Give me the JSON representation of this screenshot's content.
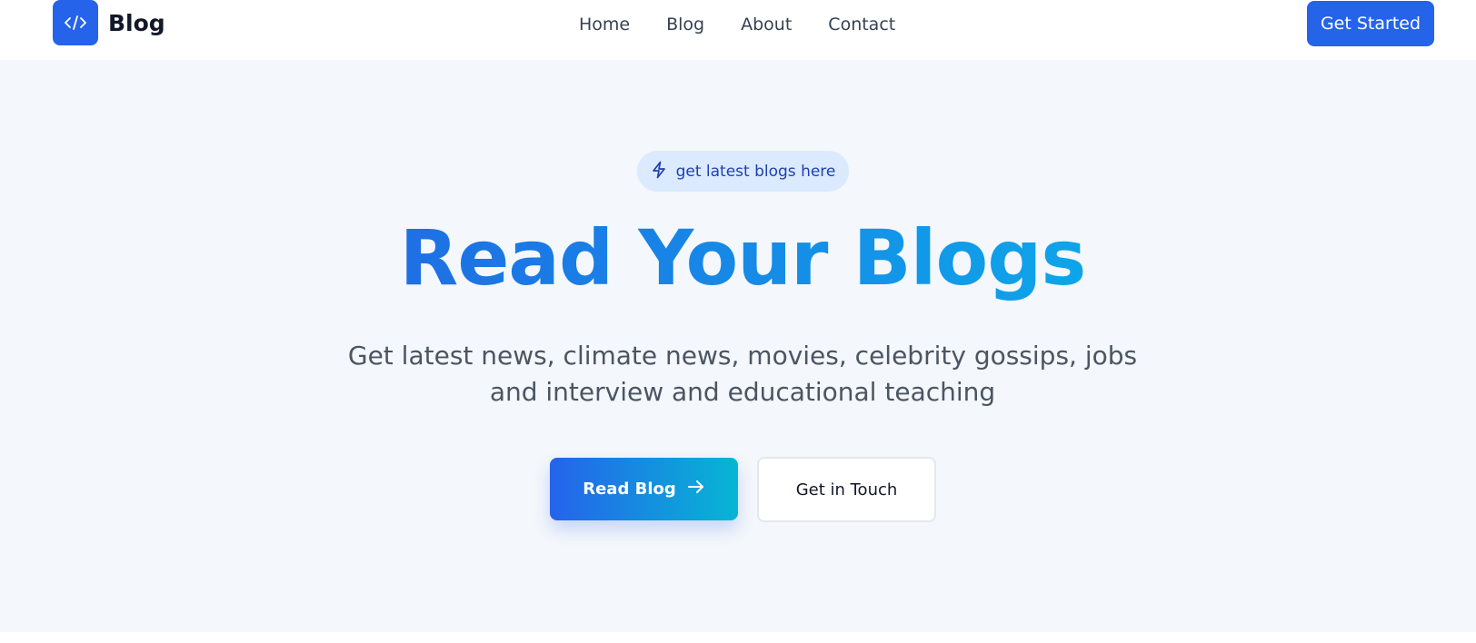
{
  "header": {
    "brand_name": "Blog",
    "logo_icon": "code-icon",
    "nav": [
      {
        "label": "Home"
      },
      {
        "label": "Blog"
      },
      {
        "label": "About"
      },
      {
        "label": "Contact"
      }
    ],
    "cta_label": "Get Started"
  },
  "hero": {
    "badge_icon": "lightning-icon",
    "badge_text": "get latest blogs here",
    "title": "Read Your Blogs",
    "subtitle": "Get latest news, climate news, movies, celebrity gossips, jobs and interview and educational teaching",
    "primary_button": "Read Blog",
    "primary_button_icon": "arrow-right-icon",
    "secondary_button": "Get in Touch"
  },
  "colors": {
    "accent": "#2563eb",
    "gradient_end": "#06b6d4",
    "hero_background": "#f4f7fb",
    "badge_background": "#dbeafe",
    "badge_text": "#1e40af"
  }
}
